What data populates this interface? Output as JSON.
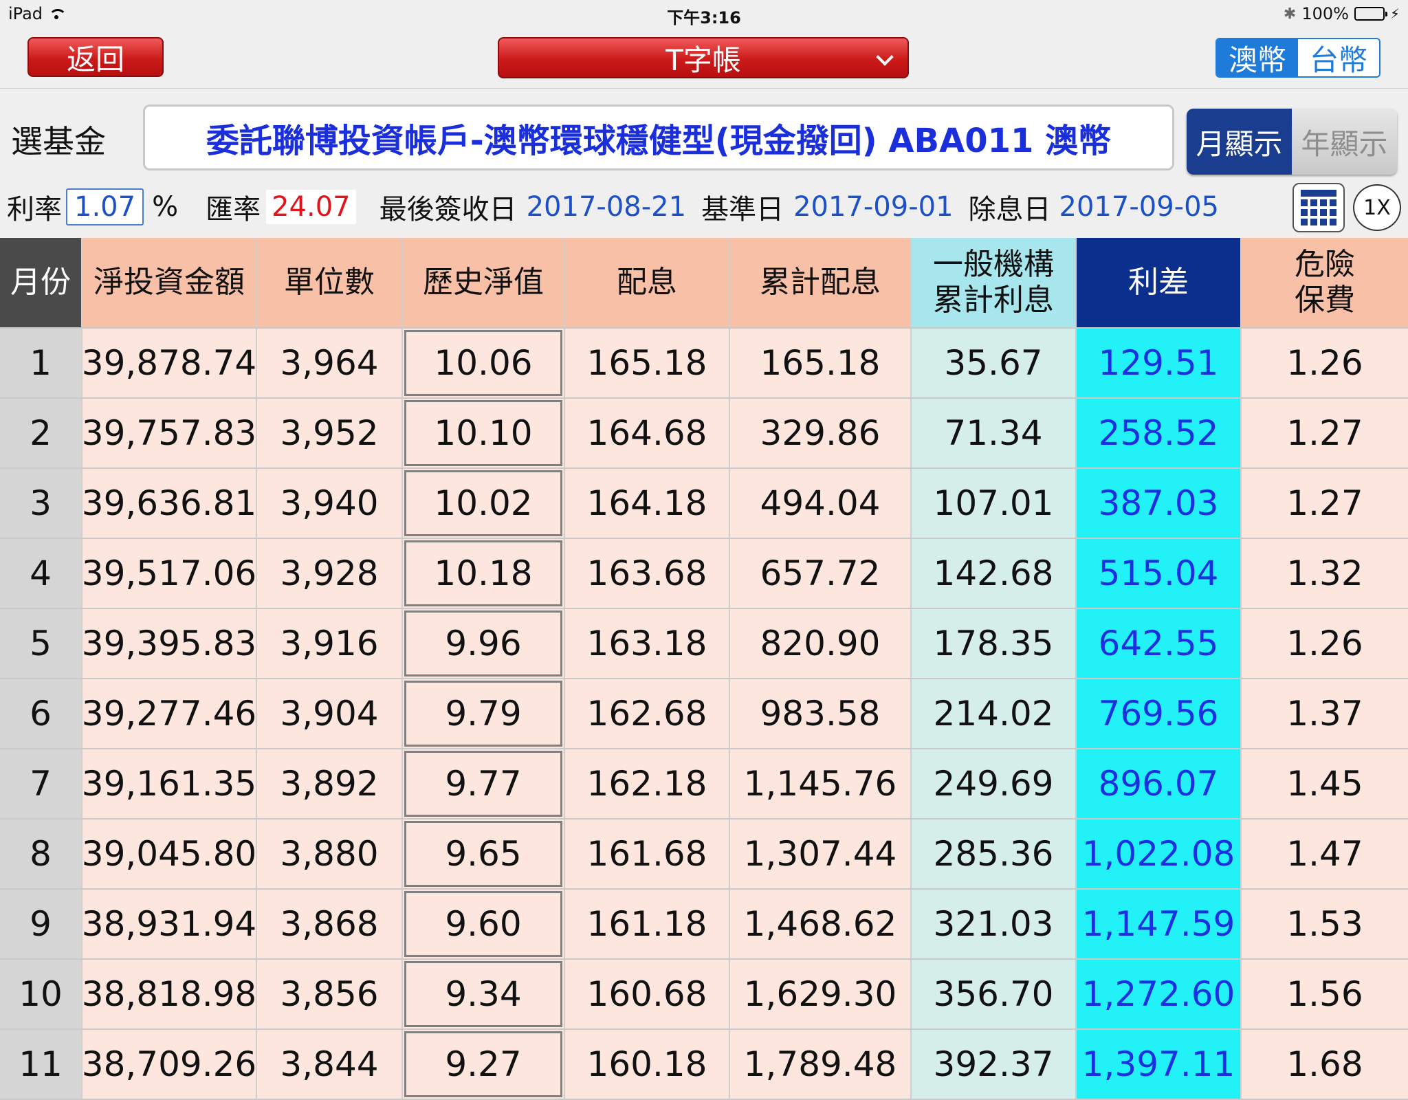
{
  "status_bar": {
    "device": "iPad",
    "time": "下午3:16",
    "battery": "100%",
    "battery_level": 1.0
  },
  "nav": {
    "back_label": "返回",
    "title": "T字帳",
    "currency_options": [
      "澳幣",
      "台幣"
    ],
    "currency_selected": "澳幣"
  },
  "fund": {
    "label": "選基金",
    "value": "委託聯博投資帳戶-澳幣環球穩健型(現金撥回) ABA011 澳幣",
    "view_options": [
      "月顯示",
      "年顯示"
    ],
    "view_selected": "月顯示"
  },
  "info": {
    "rate_label": "利率",
    "rate_value": "1.07",
    "rate_unit": "%",
    "fx_label": "匯率",
    "fx_value": "24.07",
    "last_sign_label": "最後簽收日",
    "last_sign_value": "2017-08-21",
    "base_label": "基準日",
    "base_value": "2017-09-01",
    "exdiv_label": "除息日",
    "exdiv_value": "2017-09-05",
    "zoom_label": "1X"
  },
  "table": {
    "headers": [
      "月份",
      "淨投資金額",
      "單位數",
      "歷史淨值",
      "配息",
      "累計配息",
      "一般機構\n累計利息",
      "利差",
      "危險\n保費"
    ],
    "rows": [
      [
        "1",
        "39,878.74",
        "3,964",
        "10.06",
        "165.18",
        "165.18",
        "35.67",
        "129.51",
        "1.26"
      ],
      [
        "2",
        "39,757.83",
        "3,952",
        "10.10",
        "164.68",
        "329.86",
        "71.34",
        "258.52",
        "1.27"
      ],
      [
        "3",
        "39,636.81",
        "3,940",
        "10.02",
        "164.18",
        "494.04",
        "107.01",
        "387.03",
        "1.27"
      ],
      [
        "4",
        "39,517.06",
        "3,928",
        "10.18",
        "163.68",
        "657.72",
        "142.68",
        "515.04",
        "1.32"
      ],
      [
        "5",
        "39,395.83",
        "3,916",
        "9.96",
        "163.18",
        "820.90",
        "178.35",
        "642.55",
        "1.26"
      ],
      [
        "6",
        "39,277.46",
        "3,904",
        "9.79",
        "162.68",
        "983.58",
        "214.02",
        "769.56",
        "1.37"
      ],
      [
        "7",
        "39,161.35",
        "3,892",
        "9.77",
        "162.18",
        "1,145.76",
        "249.69",
        "896.07",
        "1.45"
      ],
      [
        "8",
        "39,045.80",
        "3,880",
        "9.65",
        "161.68",
        "1,307.44",
        "285.36",
        "1,022.08",
        "1.47"
      ],
      [
        "9",
        "38,931.94",
        "3,868",
        "9.60",
        "161.18",
        "1,468.62",
        "321.03",
        "1,147.59",
        "1.53"
      ],
      [
        "10",
        "38,818.98",
        "3,856",
        "9.34",
        "160.68",
        "1,629.30",
        "356.70",
        "1,272.60",
        "1.56"
      ],
      [
        "11",
        "38,709.26",
        "3,844",
        "9.27",
        "160.18",
        "1,789.48",
        "392.37",
        "1,397.11",
        "1.68"
      ]
    ]
  },
  "colors": {
    "header_peach": "#f9c0a8",
    "body_peach": "#fde6dd",
    "header_aqua": "#a8e6ee",
    "body_aqua": "#d6eeea",
    "spread_cyan": "#22f2f7",
    "navy": "#0b2f8c",
    "button_red": "#cc1a1a",
    "accent_blue": "#1e7bd9"
  }
}
